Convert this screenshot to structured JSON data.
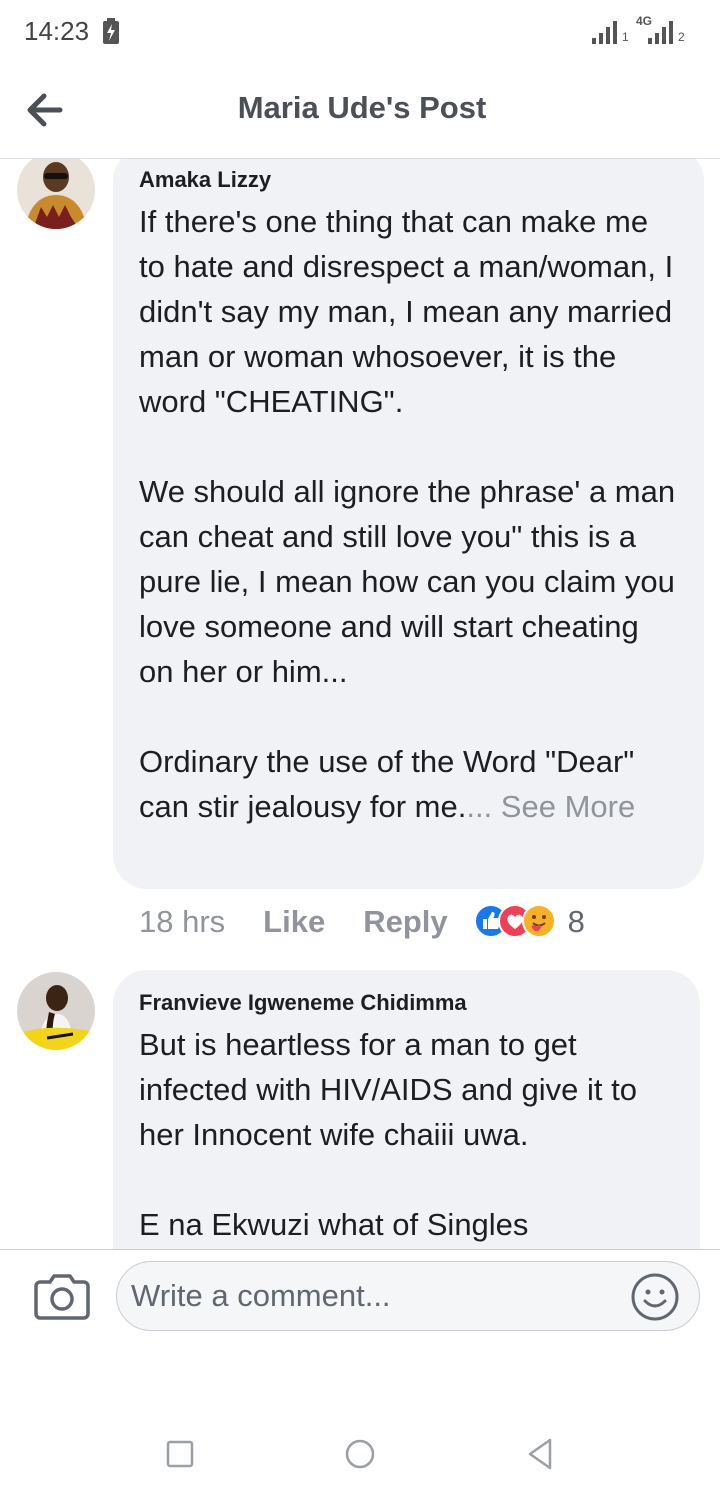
{
  "status_bar": {
    "time": "14:23",
    "network": "4G",
    "sim1": "1",
    "sim2": "2"
  },
  "header": {
    "title": "Maria Ude's Post"
  },
  "comments": [
    {
      "author": "Amaka Lizzy",
      "paragraphs": [
        "If there's one thing that can make me to hate and disrespect a man/woman, I didn't say my man, I mean any married man or woman whosoever, it is the word \"CHEATING\".",
        "We should all ignore the phrase' a man can cheat and still love you\" this is a pure lie, I mean how can you claim you love someone and will start cheating on her or him..."
      ],
      "last_paragraph": "Ordinary the use of the Word \"Dear\" can stir jealousy for me.",
      "see_more": "... See More",
      "time": "18 hrs",
      "like_label": "Like",
      "reply_label": "Reply",
      "reaction_count": "8",
      "reaction_icons": [
        "like-icon",
        "love-icon",
        "care-icon"
      ],
      "colors": {
        "like": "#1877f2",
        "love": "#f33e58",
        "care": "#f7b125"
      }
    },
    {
      "author": "Franvieve Igweneme Chidimma",
      "paragraphs": [
        "But is heartless for a man to get infected with HIV/AIDS and give it to her Innocent wife chaiii uwa.",
        "E na Ekwuzi what of Singles"
      ]
    }
  ],
  "composer": {
    "placeholder": "Write a comment..."
  },
  "colors": {
    "bubble": "#f0f2f5",
    "secondary_text": "#90949c",
    "title_text": "#4b4f56"
  }
}
